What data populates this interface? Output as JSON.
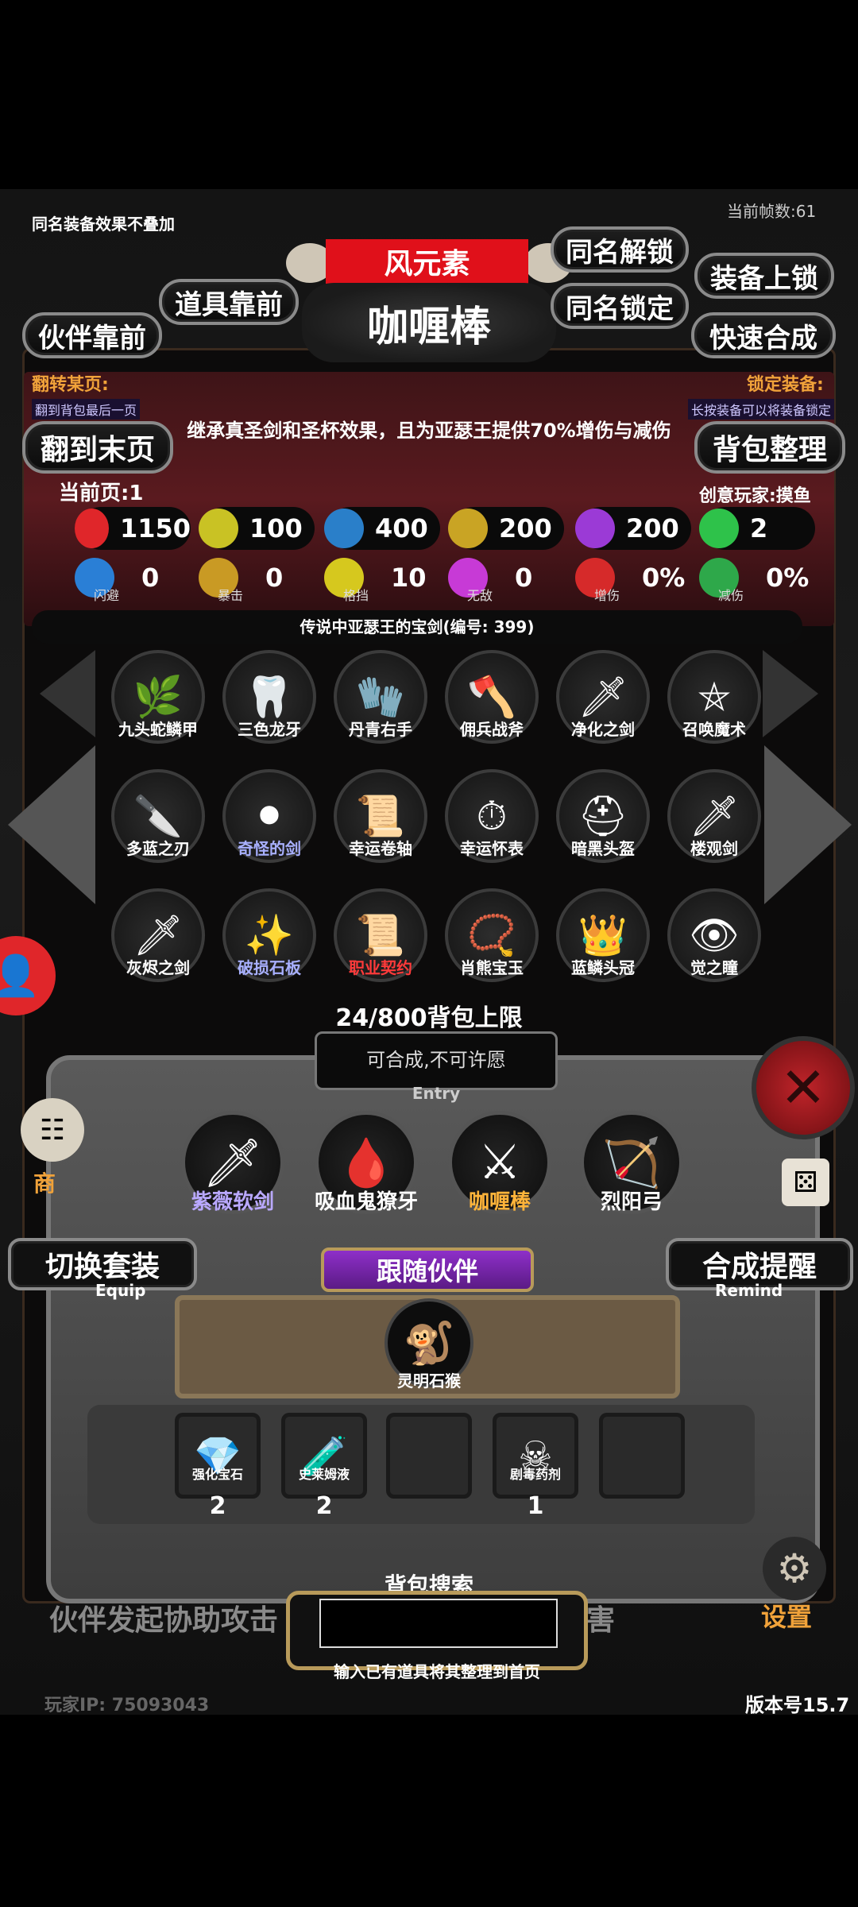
{
  "top": {
    "notice": "同名装备效果不叠加",
    "fps": "当前帧数:61"
  },
  "buttons": {
    "element": "风元素",
    "unlock_same": "同名解锁",
    "lock_equip": "装备上锁",
    "items_first": "道具靠前",
    "lock_same": "同名锁定",
    "partner_first": "伙伴靠前",
    "quick_merge": "快速合成",
    "last_page": "翻到末页",
    "sort_bag": "背包整理",
    "switch_set": "切换套装",
    "switch_set_en": "Equip",
    "merge_remind": "合成提醒",
    "merge_remind_en": "Remind",
    "follow_partner": "跟随伙伴"
  },
  "item": {
    "name": "咖喱棒",
    "desc": "继承真圣剑和圣杯效果，且为亚瑟王提供70%增伤与减伤",
    "caption": "传说中亚瑟王的宝剑(编号: 399)"
  },
  "flip": {
    "title": "翻转某页:",
    "hint": "翻到背包最后一页"
  },
  "lockeq": {
    "title": "锁定装备:",
    "hint": "长按装备可以将装备锁定"
  },
  "page": {
    "current": "当前页:1",
    "creator": "创意玩家:摸鱼"
  },
  "stats": [
    {
      "icon": "heart-icon",
      "value": "1150",
      "color": "#e0262a"
    },
    {
      "icon": "strength-icon",
      "value": "100",
      "color": "#c9c224"
    },
    {
      "icon": "helmet-icon",
      "value": "400",
      "color": "#2a7fc9"
    },
    {
      "icon": "sword-icon",
      "value": "200",
      "color": "#c9a424"
    },
    {
      "icon": "lightning-icon",
      "value": "200",
      "color": "#9b3ad6"
    },
    {
      "icon": "clover-icon",
      "value": "2",
      "color": "#2ec24a"
    }
  ],
  "stats2": [
    {
      "icon": "dodge-icon",
      "value": "0",
      "label": "闪避",
      "color": "#2a7fd6"
    },
    {
      "icon": "crit-icon",
      "value": "0",
      "label": "暴击",
      "color": "#c99a24"
    },
    {
      "icon": "shield-icon",
      "value": "10",
      "label": "格挡",
      "color": "#d6c81e"
    },
    {
      "icon": "wings-icon",
      "value": "0",
      "label": "无敌",
      "color": "#c73ad6"
    },
    {
      "icon": "broken-sword-icon",
      "value": "0%",
      "label": "增伤",
      "color": "#d62a2a"
    },
    {
      "icon": "green-shield-icon",
      "value": "0%",
      "label": "减伤",
      "color": "#2ea84a"
    }
  ],
  "grid": [
    {
      "name": "九头蛇鳞甲",
      "glyph": "🌿",
      "color": "#fff"
    },
    {
      "name": "三色龙牙",
      "glyph": "🦷",
      "color": "#fff"
    },
    {
      "name": "丹青右手",
      "glyph": "🧤",
      "color": "#fff"
    },
    {
      "name": "佣兵战斧",
      "glyph": "🪓",
      "color": "#fff"
    },
    {
      "name": "净化之剑",
      "glyph": "🗡",
      "color": "#fff"
    },
    {
      "name": "召唤魔术",
      "glyph": "⛤",
      "color": "#fff"
    },
    {
      "name": "多蓝之刃",
      "glyph": "🔪",
      "color": "#fff"
    },
    {
      "name": "奇怪的剑",
      "glyph": "⚫",
      "color": "#a8b0ff"
    },
    {
      "name": "幸运卷轴",
      "glyph": "📜",
      "color": "#fff"
    },
    {
      "name": "幸运怀表",
      "glyph": "⏱",
      "color": "#fff"
    },
    {
      "name": "暗黑头盔",
      "glyph": "⛑",
      "color": "#fff"
    },
    {
      "name": "楼观剑",
      "glyph": "🗡",
      "color": "#fff"
    },
    {
      "name": "灰烬之剑",
      "glyph": "🗡",
      "color": "#fff"
    },
    {
      "name": "破损石板",
      "glyph": "✨",
      "color": "#a8b0ff"
    },
    {
      "name": "职业契约",
      "glyph": "📜",
      "color": "#ff3a3a"
    },
    {
      "name": "肖熊宝玉",
      "glyph": "📿",
      "color": "#fff"
    },
    {
      "name": "蓝鳞头冠",
      "glyph": "👑",
      "color": "#fff"
    },
    {
      "name": "觉之瞳",
      "glyph": "👁",
      "color": "#fff"
    }
  ],
  "bag_limit": "24/800背包上限",
  "entry": {
    "text": "可合成,不可许愿",
    "label": "Entry"
  },
  "equipped": [
    {
      "name": "紫薇软剑",
      "glyph": "🗡",
      "color": "#b9a8ff"
    },
    {
      "name": "吸血鬼獠牙",
      "glyph": "🩸",
      "color": "#fff"
    },
    {
      "name": "咖喱棒",
      "glyph": "⚔",
      "color": "#ffb43a"
    },
    {
      "name": "烈阳弓",
      "glyph": "🏹",
      "color": "#fff"
    }
  ],
  "partner": {
    "name": "灵明石猴",
    "glyph": "🐒"
  },
  "inventory": [
    {
      "name": "强化宝石",
      "glyph": "💎",
      "count": "2"
    },
    {
      "name": "史莱姆液",
      "glyph": "🧪",
      "count": "2"
    },
    {
      "name": "",
      "glyph": "",
      "count": ""
    },
    {
      "name": "剧毒药剂",
      "glyph": "☠",
      "count": "1"
    },
    {
      "name": "",
      "glyph": "",
      "count": ""
    }
  ],
  "search": {
    "title": "背包搜索",
    "hint": "输入已有道具将其整理到首页",
    "placeholder": ""
  },
  "footer": {
    "partner_msg_left": "伙伴发起协助攻击",
    "partner_msg_right": "害",
    "settings": "设置",
    "shop": "商",
    "player_ip": "玩家IP: 75093043",
    "version": "版本号15.7"
  }
}
